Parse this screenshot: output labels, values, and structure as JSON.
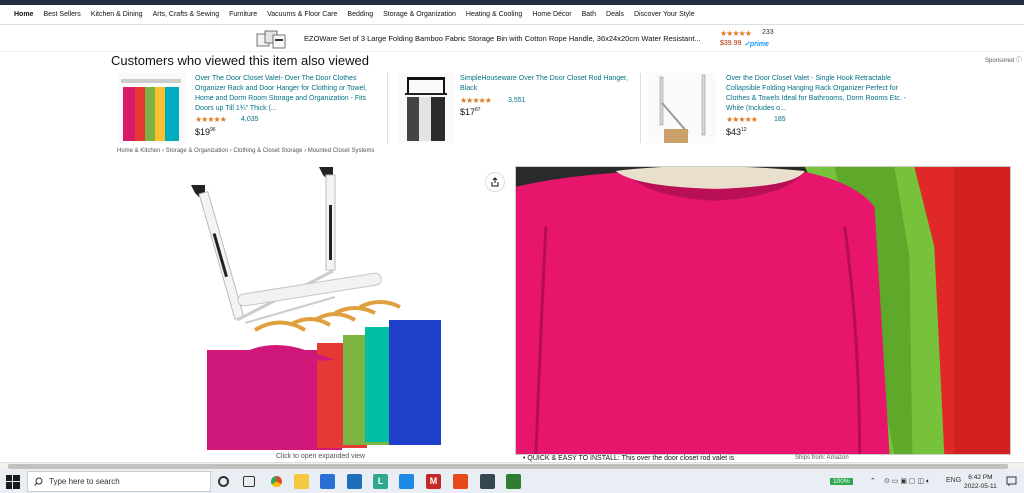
{
  "nav": {
    "items": [
      "Home",
      "Best Sellers",
      "Kitchen & Dining",
      "Arts, Crafts & Sewing",
      "Furniture",
      "Vacuums & Floor Care",
      "Bedding",
      "Storage & Organization",
      "Heating & Cooling",
      "Home Décor",
      "Bath",
      "Deals",
      "Discover Your Style"
    ]
  },
  "ad": {
    "title": "EZOWare Set of 3 Large Folding Bamboo Fabric Storage Bin with Cotton Rope Handle, 36x24x20cm Water Resistant...",
    "stars": "★★★★★",
    "count": "233",
    "price": "$39.99",
    "prime": "✓prime",
    "sponsored": "Sponsored ⓘ"
  },
  "cwv": {
    "heading": "Customers who viewed this item also viewed",
    "cards": [
      {
        "title": "Over The Door Closet Valet- Over The Door Clothes Organizer Rack and Door Hanger for Clothing or Towel, Home and Dorm Room Storage and Organization - Fits Doors up Till 1¾\" Thick (...",
        "stars": "★★★★★",
        "count": "4,035",
        "price_whole": "19",
        "price_frac": "96"
      },
      {
        "title": "SimpleHouseware Over The Door Closet Rod Hanger, Black",
        "stars": "★★★★★",
        "count": "3,551",
        "price_whole": "17",
        "price_frac": "87"
      },
      {
        "title": "Over the Door Closet Valet - Single Hook Retractable Collapsible Folding Hanging Rack Organizer Perfect for Clothes & Towels Ideal for Bathrooms, Dorm Rooms Etc. - White (Includes o...",
        "stars": "★★★★★",
        "count": "185",
        "price_whole": "43",
        "price_frac": "12"
      }
    ]
  },
  "breadcrumb": "Home & Kitchen › Storage & Organization › Clothing & Closet Storage › Mounted Closet Systems",
  "product": {
    "click_open": "Click to open expanded view",
    "bullet": "QUICK & EASY TO INSTALL: This over the door closet rod valet is",
    "ships_from": "Ships from: Amazon"
  },
  "taskbar": {
    "search_placeholder": "Type here to search",
    "battery": "100%",
    "lang": "ENG",
    "time": "6:42 PM",
    "date": "2022-05-11"
  }
}
